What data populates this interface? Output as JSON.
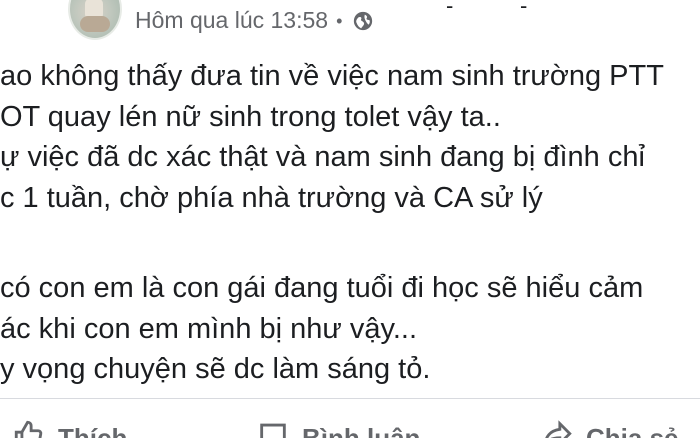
{
  "post": {
    "timestamp": "Hôm qua lúc 13:58",
    "separator": "•",
    "privacy_icon": "globe-icon",
    "top_cropped": [
      "-",
      "-"
    ],
    "lines": [
      "ao không thấy đưa tin về việc nam sinh trường PTT",
      "OT quay lén nữ sinh trong tolet vậy ta..",
      "ự việc đã dc xác thật và nam sinh đang bị đình chỉ",
      "c 1 tuần, chờ phía nhà trường và CA sử lý",
      "",
      " có con em là con gái đang tuổi đi học sẽ hiểu cảm",
      "ác khi con em mình bị như vậy...",
      "y vọng chuyện sẽ dc làm sáng tỏ."
    ]
  },
  "actions": {
    "like_label": "Thích",
    "comment_label": "Bình luận",
    "share_label": "Chia sẻ",
    "like_icon": "thumbs-up-icon",
    "comment_icon": "comment-icon",
    "share_icon": "share-icon"
  },
  "colors": {
    "text": "#1c1e21",
    "meta": "#65676b",
    "divider": "#d8dadf"
  }
}
